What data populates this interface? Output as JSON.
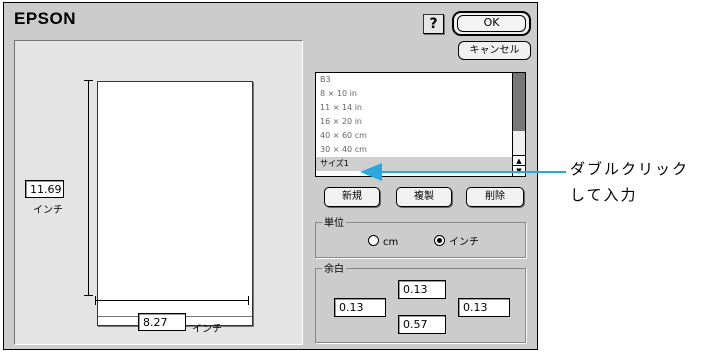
{
  "dialog": {
    "brand": "EPSON",
    "help_label": "?",
    "ok_label": "OK",
    "cancel_label": "キャンセル"
  },
  "preview": {
    "height_value": "11.69",
    "height_unit": "インチ",
    "width_value": "8.27",
    "width_unit": "インチ"
  },
  "size_list": {
    "items": [
      "B3",
      "8 × 10 in",
      "11 × 14 in",
      "16 × 20 in",
      "40 × 60 cm",
      "30 × 40 cm",
      "サイズ1"
    ],
    "selected": "サイズ1"
  },
  "actions": {
    "new_label": "新規",
    "duplicate_label": "複製",
    "delete_label": "削除"
  },
  "unit_group": {
    "title": "単位",
    "options": [
      "cm",
      "インチ"
    ],
    "selected": "インチ"
  },
  "margin_group": {
    "title": "余白",
    "top": "0.13",
    "left": "0.13",
    "right": "0.13",
    "bottom": "0.57"
  },
  "annotation": {
    "line1": "ダブルクリック",
    "line2": "して入力",
    "arrow_color": "#29a8df"
  }
}
